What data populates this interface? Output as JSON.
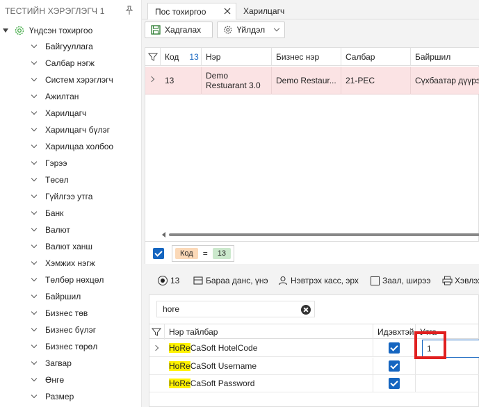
{
  "sidebar": {
    "header": "ТЕСТИЙН ХЭРЭГЛЭГЧ 1",
    "root": "Үндсэн тохиргоо",
    "items": [
      "Байгууллага",
      "Салбар нэгж",
      "Систем хэрэглэгч",
      "Ажилтан",
      "Харилцагч",
      "Харилцагч бүлэг",
      "Харилцаа холбоо",
      "Гэрээ",
      "Төсөл",
      "Гүйлгээ утга",
      "Банк",
      "Валют",
      "Валют ханш",
      "Хэмжих нэгж",
      "Төлбөр нөхцөл",
      "Байршил",
      "Бизнес төв",
      "Бизнес бүлэг",
      "Бизнес төрөл",
      "Загвар",
      "Өнгө",
      "Размер"
    ]
  },
  "tabs": {
    "active": "Пос тохиргоо",
    "second": "Харилцагч"
  },
  "toolbar": {
    "save": "Хадгалах",
    "action": "Үйлдэл"
  },
  "grid1": {
    "headers": {
      "code": "Код",
      "code_count": "13",
      "name": "Нэр",
      "biz": "Бизнес нэр",
      "branch": "Салбар",
      "loc": "Байршил"
    },
    "row": {
      "code": "13",
      "name1": "Demo",
      "name2": "Restuarant 3.0",
      "biz": "Demo Restaur...",
      "branch": "21-PEC",
      "loc": "Сүхбаатар дүүрэ"
    },
    "filter": {
      "field": "Код",
      "op": "=",
      "value": "13"
    }
  },
  "detail_tabs": {
    "t1": "13",
    "t2": "Бараа данс, үнэ",
    "t3": "Нэвтрэх касс, эрх",
    "t4": "Заал, ширээ",
    "t5": "Хэвлэх"
  },
  "grid2": {
    "search": "hore",
    "headers": {
      "name": "Нэр тайлбар",
      "active": "Идэвхтэй",
      "value": "Утга"
    },
    "rows": [
      {
        "hl": "HoRe",
        "rest": "CaSoft HotelCode",
        "value": "1"
      },
      {
        "hl": "HoRe",
        "rest": "CaSoft Username",
        "value": ""
      },
      {
        "hl": "HoRe",
        "rest": "CaSoft Password",
        "value": ""
      }
    ]
  }
}
